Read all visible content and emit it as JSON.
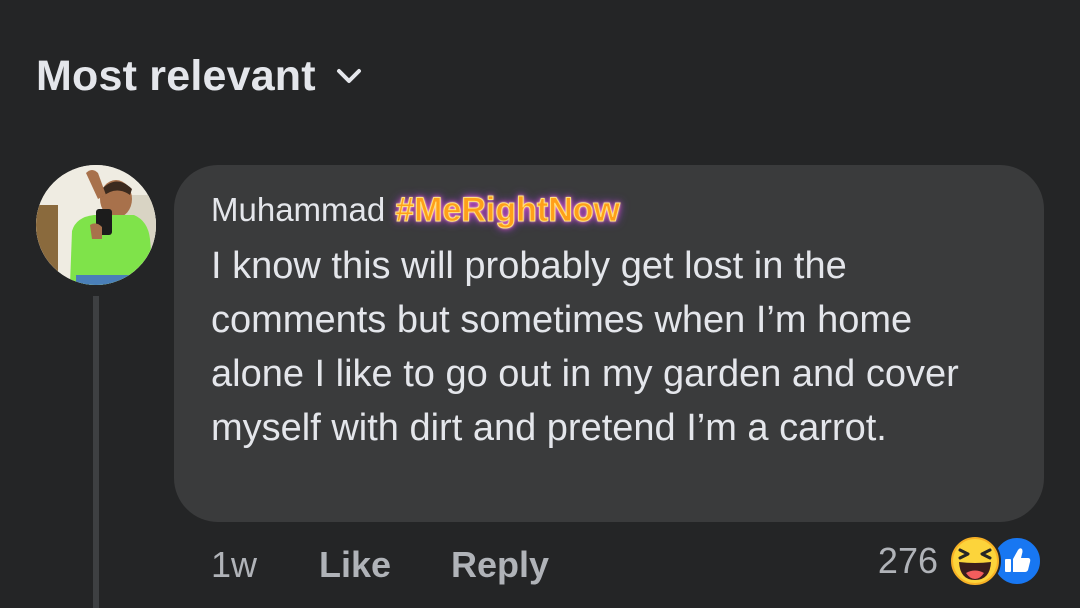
{
  "sort": {
    "label": "Most relevant"
  },
  "comment": {
    "author": "Muhammad",
    "hashtag": "#MeRightNow",
    "text": "I know this will probably get lost in the comments but sometimes when I’m home alone I like to go out in my garden and cover myself with dirt and pretend I’m a carrot.",
    "time": "1w",
    "like_label": "Like",
    "reply_label": "Reply",
    "reaction_count": "276",
    "reactions": [
      "haha-icon",
      "like-icon"
    ]
  },
  "colors": {
    "background": "#242526",
    "bubble": "#3a3b3c",
    "text_primary": "#e4e6eb",
    "text_secondary": "#b0b3b8",
    "like_blue": "#1877f2",
    "haha_yellow": "#f7b125"
  }
}
